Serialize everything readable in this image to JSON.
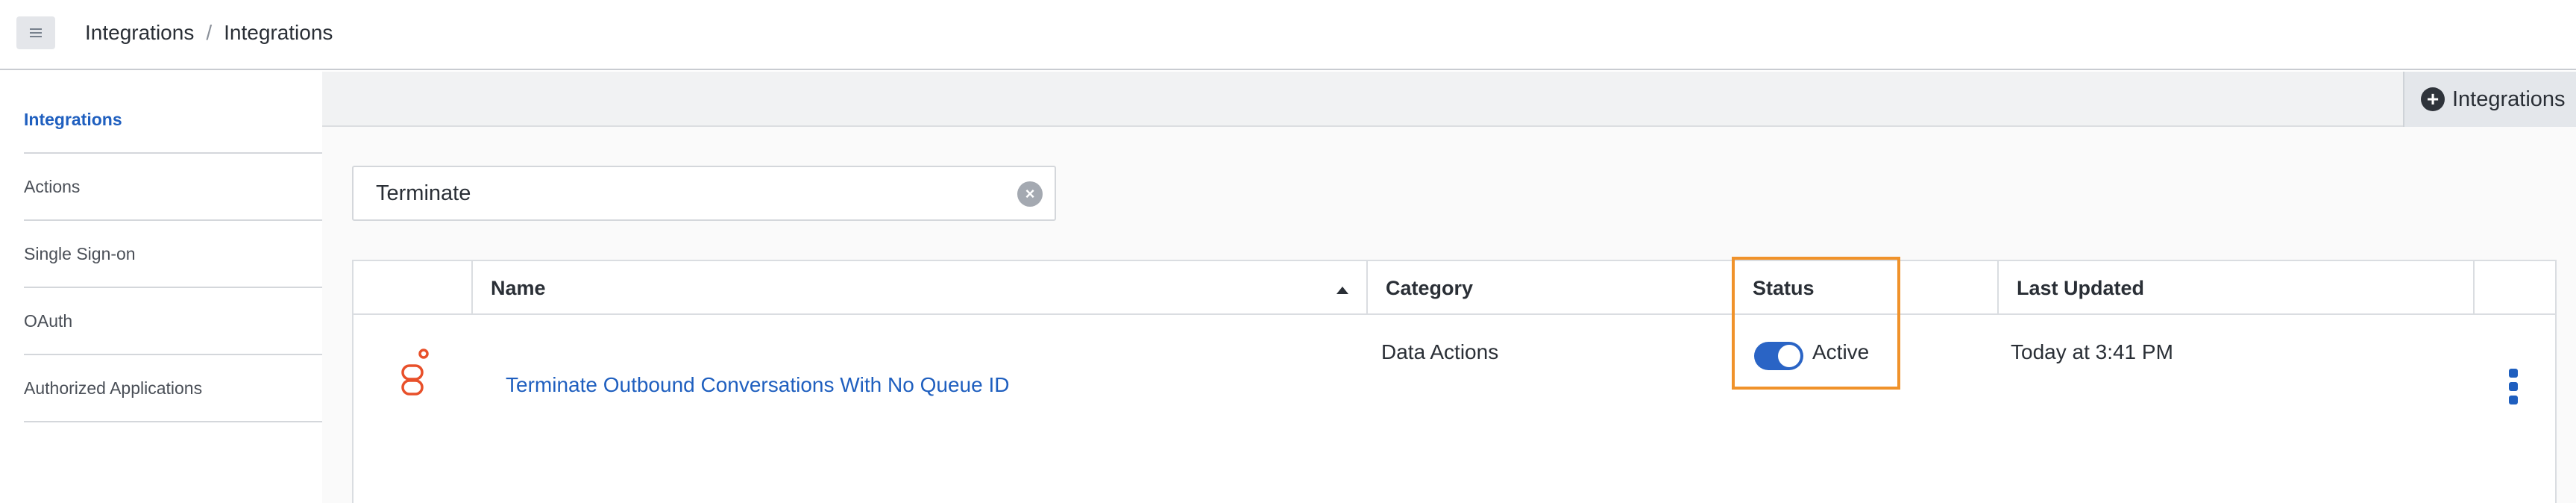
{
  "breadcrumb": {
    "first": "Integrations",
    "separator": "/",
    "second": "Integrations"
  },
  "sidebar": {
    "items": [
      {
        "label": "Integrations",
        "active": true
      },
      {
        "label": "Actions",
        "active": false
      },
      {
        "label": "Single Sign-on",
        "active": false
      },
      {
        "label": "OAuth",
        "active": false
      },
      {
        "label": "Authorized Applications",
        "active": false
      }
    ]
  },
  "toolbar": {
    "add_label": "Integrations"
  },
  "search": {
    "value": "Terminate"
  },
  "table": {
    "columns": [
      "Name",
      "Category",
      "Status",
      "Last Updated"
    ],
    "rows": [
      {
        "name": "Terminate Outbound Conversations With No Queue ID",
        "category": "Data Actions",
        "status": "Active",
        "status_on": true,
        "last_updated": "Today at 3:41 PM"
      }
    ]
  },
  "colors": {
    "accent": "#1f5fbf",
    "toggle": "#2a64c5",
    "highlight": "#f0922a",
    "logo": "#e8502a"
  }
}
